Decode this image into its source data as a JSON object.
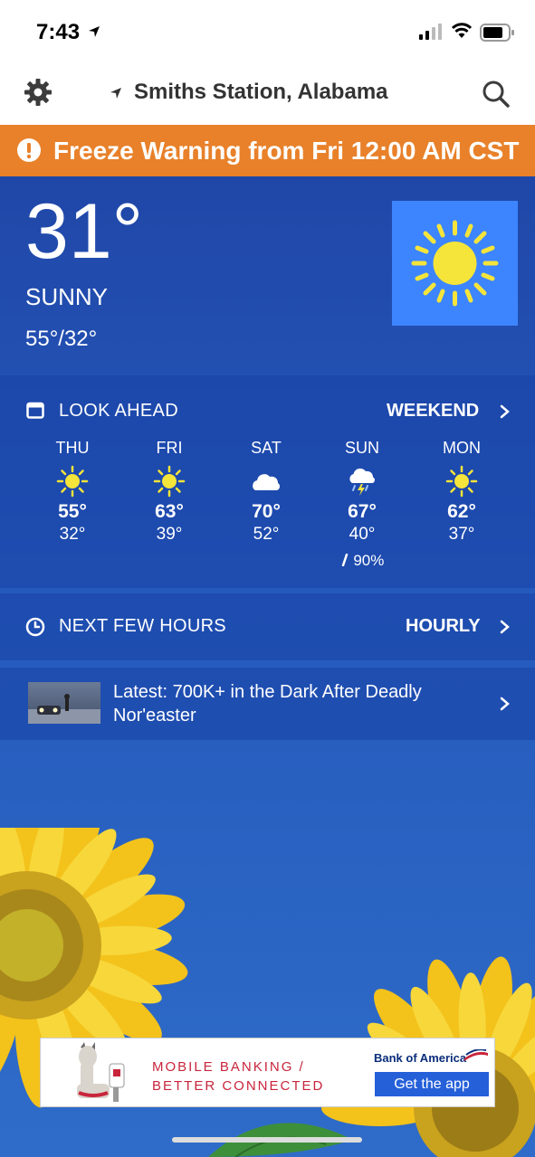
{
  "status_bar": {
    "time": "7:43"
  },
  "header": {
    "location": "Smiths Station, Alabama"
  },
  "alert": {
    "text": "Freeze Warning from Fri 12:00 AM CST"
  },
  "current": {
    "temperature": "31°",
    "condition": "SUNNY",
    "hi_lo": "55°/32°",
    "icon": "sun-icon"
  },
  "look_ahead": {
    "title": "LOOK AHEAD",
    "link": "WEEKEND",
    "days": [
      {
        "name": "THU",
        "icon": "sun-icon",
        "hi": "55°",
        "lo": "32°",
        "precip": ""
      },
      {
        "name": "FRI",
        "icon": "sun-icon",
        "hi": "63°",
        "lo": "39°",
        "precip": ""
      },
      {
        "name": "SAT",
        "icon": "cloud-icon",
        "hi": "70°",
        "lo": "52°",
        "precip": ""
      },
      {
        "name": "SUN",
        "icon": "thunderstorm-icon",
        "hi": "67°",
        "lo": "40°",
        "precip": "90%"
      },
      {
        "name": "MON",
        "icon": "sun-icon",
        "hi": "62°",
        "lo": "37°",
        "precip": ""
      }
    ]
  },
  "next_hours": {
    "title": "NEXT FEW HOURS",
    "link": "HOURLY"
  },
  "news": {
    "headline": "Latest: 700K+ in the Dark After Deadly Nor'easter"
  },
  "ad": {
    "line1": "MOBILE BANKING /",
    "line2": "BETTER CONNECTED",
    "brand": "Bank of America",
    "cta": "Get the app"
  },
  "colors": {
    "alert": "#e8812a",
    "sky": "#2459bb",
    "sun": "#f5e43a",
    "sun_box": "#3c85ff"
  }
}
